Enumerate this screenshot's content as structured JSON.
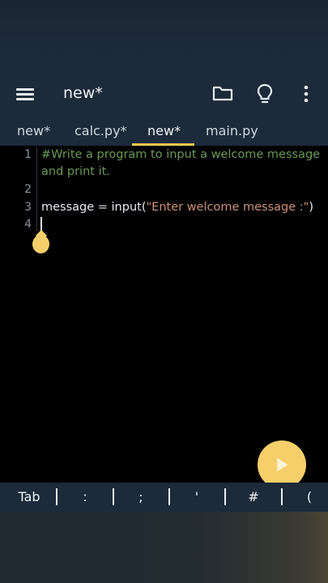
{
  "appbar": {
    "title": "new*",
    "icons": [
      "menu-icon",
      "folder-icon",
      "lightbulb-icon",
      "more-vert-icon"
    ]
  },
  "tabs": [
    {
      "label": "new*",
      "active": false
    },
    {
      "label": "calc.py*",
      "active": false
    },
    {
      "label": "new*",
      "active": true
    },
    {
      "label": "main.py",
      "active": false
    }
  ],
  "editor": {
    "line_numbers": [
      "1",
      "2",
      "3",
      "4"
    ],
    "lines": {
      "l1a": "#Write a program to input a welcome message",
      "l1b": "and print it.",
      "l3_var": "message = input(",
      "l3_str": "\"Enter welcome message :\"",
      "l3_end": ")"
    }
  },
  "keys": [
    "Tab",
    ":",
    ";",
    "'",
    "#",
    "("
  ],
  "colors": {
    "accent": "#f2c94c",
    "comment": "#6a9955",
    "string": "#ce9178",
    "bar": "#1c2a3a"
  }
}
